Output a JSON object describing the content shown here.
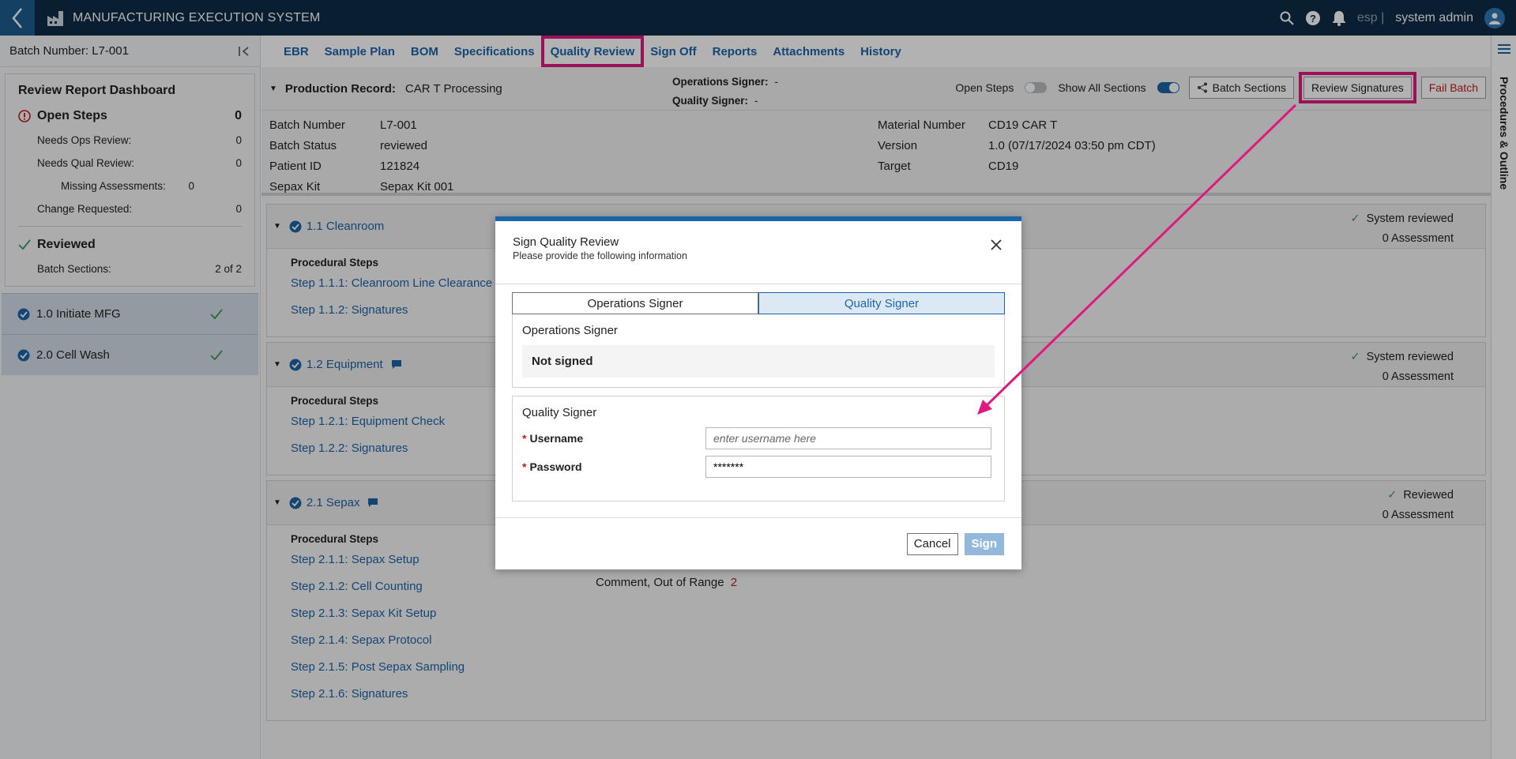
{
  "app": {
    "title": "MANUFACTURING EXECUTION SYSTEM",
    "lang": "esp |",
    "user": "system admin"
  },
  "sidebar": {
    "batch_label": "Batch Number: L7-001",
    "dashboard_title": "Review Report Dashboard",
    "open_steps": {
      "label": "Open Steps",
      "value": "0"
    },
    "needs_ops": {
      "label": "Needs Ops Review:",
      "value": "0"
    },
    "needs_qual": {
      "label": "Needs Qual Review:",
      "value": "0"
    },
    "missing": {
      "label": "Missing Assessments:",
      "value": "0"
    },
    "change_req": {
      "label": "Change Requested:",
      "value": "0"
    },
    "reviewed": {
      "label": "Reviewed"
    },
    "batch_sections": {
      "label": "Batch Sections:",
      "value": "2 of 2"
    },
    "items": [
      {
        "label": "1.0 Initiate MFG"
      },
      {
        "label": "2.0 Cell Wash"
      }
    ]
  },
  "tabs": [
    "EBR",
    "Sample Plan",
    "BOM",
    "Specifications",
    "Quality Review",
    "Sign Off",
    "Reports",
    "Attachments",
    "History"
  ],
  "rail_label": "Procedures & Outline",
  "record": {
    "label": "Production Record:",
    "value": "CAR T Processing",
    "ops_signer_label": "Operations Signer:",
    "ops_signer_value": "-",
    "qual_signer_label": "Quality Signer:",
    "qual_signer_value": "-",
    "open_steps_toggle": "Open Steps",
    "show_all_toggle": "Show All Sections",
    "batch_sections_btn": "Batch Sections",
    "review_signatures_btn": "Review Signatures",
    "fail_batch_btn": "Fail Batch"
  },
  "meta": [
    [
      "Batch Number",
      "L7-001",
      "Material Number",
      "CD19 CAR T"
    ],
    [
      "Batch Status",
      "reviewed",
      "Version",
      "1.0 (07/17/2024 03:50 pm CDT)"
    ],
    [
      "Patient ID",
      "121824",
      "Target",
      "CD19"
    ],
    [
      "Sepax Kit",
      "Sepax Kit 001",
      "",
      ""
    ]
  ],
  "sections": [
    {
      "title": "1.1 Cleanroom",
      "status": "System reviewed",
      "assessment": "0 Assessment",
      "procedural": "Procedural Steps",
      "steps": [
        "Step 1.1.1: Cleanroom Line Clearance",
        "Step 1.1.2: Signatures"
      ]
    },
    {
      "title": "1.2 Equipment",
      "status": "System reviewed",
      "assessment": "0 Assessment",
      "procedural": "Procedural Steps",
      "steps": [
        "Step 1.2.1: Equipment Check",
        "Step 1.2.2: Signatures"
      ]
    },
    {
      "title": "2.1 Sepax",
      "status": "Reviewed",
      "assessment": "0 Assessment",
      "procedural": "Procedural Steps",
      "steps": [
        "Step 2.1.1: Sepax Setup",
        "Step 2.1.2: Cell Counting",
        "Step 2.1.3: Sepax Kit Setup",
        "Step 2.1.4: Sepax Protocol",
        "Step 2.1.5: Post Sepax Sampling",
        "Step 2.1.6: Signatures"
      ],
      "comment": "Comment, Out of Range",
      "comment_count": "2"
    }
  ],
  "modal": {
    "title": "Sign Quality Review",
    "subtitle": "Please provide the following information",
    "seg_ops": "Operations Signer",
    "seg_qual": "Quality Signer",
    "ops_panel_title": "Operations Signer",
    "ops_status": "Not signed",
    "qual_panel_title": "Quality Signer",
    "username_label": "Username",
    "username_placeholder": "enter username here",
    "password_label": "Password",
    "password_value": "*******",
    "cancel": "Cancel",
    "sign": "Sign"
  },
  "colors": {
    "accent": "#1c64a8",
    "highlight": "#e0197d",
    "topbar": "#0d2c47",
    "danger": "#c01c1c",
    "success": "#3a9a5b"
  }
}
